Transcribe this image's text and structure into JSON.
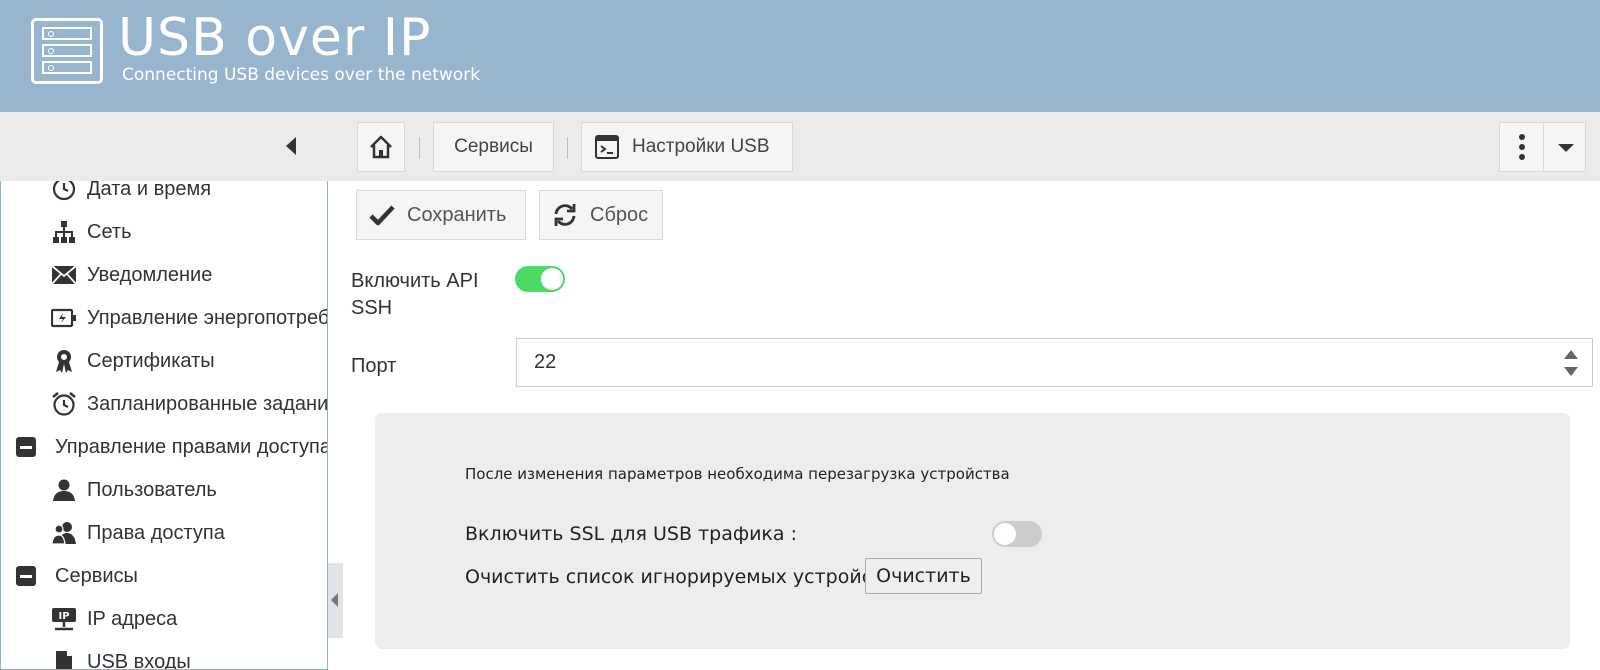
{
  "header": {
    "title": "USB over IP",
    "subtitle": "Connecting USB devices over the network"
  },
  "breadcrumb": {
    "items": [
      {
        "label": "",
        "icon": "home-icon"
      },
      {
        "label": "Сервисы"
      },
      {
        "label": "Настройки USB",
        "icon": "terminal-window-icon"
      }
    ]
  },
  "sidebar": {
    "items": [
      {
        "label": "Дата и время",
        "icon": "clock-icon",
        "level": 2
      },
      {
        "label": "Сеть",
        "icon": "network-icon",
        "level": 2
      },
      {
        "label": "Уведомление",
        "icon": "envelope-icon",
        "level": 2
      },
      {
        "label": "Управление энергопотребл",
        "icon": "battery-icon",
        "level": 2
      },
      {
        "label": "Сертификаты",
        "icon": "certificate-icon",
        "level": 2
      },
      {
        "label": "Запланированные задания",
        "icon": "alarm-clock-icon",
        "level": 2
      },
      {
        "label": "Управление правами доступа",
        "icon": "minus-square-icon",
        "level": 1
      },
      {
        "label": "Пользователь",
        "icon": "user-icon",
        "level": 2
      },
      {
        "label": "Права доступа",
        "icon": "users-icon",
        "level": 2
      },
      {
        "label": "Сервисы",
        "icon": "minus-square-icon",
        "level": 1
      },
      {
        "label": "IP адреса",
        "icon": "ip-address-icon",
        "level": 2
      },
      {
        "label": "USB входы",
        "icon": "file-icon",
        "level": 2
      }
    ]
  },
  "actions": {
    "save_label": "Сохранить",
    "reset_label": "Сброс"
  },
  "form": {
    "api_ssh_label": "Включить API SSH",
    "api_ssh_enabled": true,
    "port_label": "Порт",
    "port_value": "22"
  },
  "panel": {
    "note": "После изменения параметров необходима перезагрузка устройства",
    "ssl_label": "Включить SSL для USB трафика :",
    "ssl_enabled": false,
    "clear_label": "Очистить список игнорируемых устройств:",
    "clear_button": "Очистить"
  },
  "colors": {
    "header_bg": "#98b5cf",
    "toggle_on": "#4cd964",
    "toggle_off": "#cccccc"
  }
}
